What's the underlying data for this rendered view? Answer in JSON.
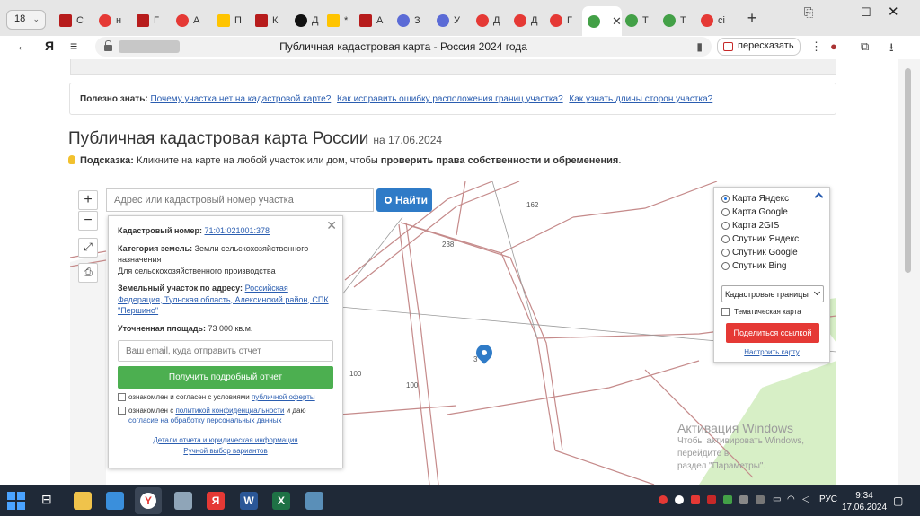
{
  "browser": {
    "tab_count": "18",
    "tabs": [
      {
        "label": "С",
        "fav": "f-e"
      },
      {
        "label": "н",
        "fav": "f-y"
      },
      {
        "label": "Г",
        "fav": "f-e"
      },
      {
        "label": "А",
        "fav": "f-y"
      },
      {
        "label": "П",
        "fav": "f-f"
      },
      {
        "label": "К",
        "fav": "f-e"
      },
      {
        "label": "Д",
        "fav": "f-k"
      },
      {
        "label": "*",
        "fav": "f-f"
      },
      {
        "label": "А",
        "fav": "f-e"
      },
      {
        "label": "З",
        "fav": "f-m"
      },
      {
        "label": "У",
        "fav": "f-m"
      },
      {
        "label": "Д",
        "fav": "f-y"
      },
      {
        "label": "Д",
        "fav": "f-y"
      },
      {
        "label": "Г",
        "fav": "f-y"
      },
      {
        "label": "",
        "fav": "f-g"
      },
      {
        "label": "Т",
        "fav": "f-g"
      },
      {
        "label": "Т",
        "fav": "f-g"
      },
      {
        "label": "ci",
        "fav": "f-y"
      }
    ],
    "page_title": "Публичная кадастровая карта - Россия 2024 года",
    "retell_label": "пересказать"
  },
  "page": {
    "useful_label": "Полезно знать:",
    "useful_links": [
      "Почему участка нет на кадастровой карте?",
      "Как исправить ошибку расположения границ участка?",
      "Как узнать длины сторон участка?"
    ],
    "heading": "Публичная кадастровая карта России",
    "heading_date": "на 17.06.2024",
    "hint_label": "Подсказка:",
    "hint_text": "Кликните на карте на любой участок или дом, чтобы",
    "hint_bold": "проверить права собственности и обременения"
  },
  "map": {
    "search_placeholder": "Адрес или кадастровый номер участка",
    "find_label": "Найти",
    "zoom_in": "+",
    "zoom_out": "−",
    "plot_labels": [
      "162",
      "238",
      "100",
      "100",
      "3"
    ],
    "popup": {
      "cad_label": "Кадастровый номер:",
      "cad_value": "71:01:021001:378",
      "cat_label": "Категория земель:",
      "cat_value": "Земли сельскохозяйственного назначения",
      "cat_value2": "Для сельскохозяйственного производства",
      "addr_label": "Земельный участок по адресу:",
      "addr_value": "Российская Федерация, Тульская область, Алексинский район, СПК \"Першино\"",
      "area_label": "Уточненная площадь:",
      "area_value": "73 000 кв.м.",
      "email_placeholder": "Ваш email, куда отправить отчет",
      "get_report": "Получить подробный отчет",
      "agree1_text": "ознакомлен и согласен с условиями",
      "agree1_link": "публичной оферты",
      "agree2_text": "ознакомлен с",
      "agree2_link": "политикой конфиденциальности",
      "agree2_text2": "и даю",
      "agree2_link2": "согласие на обработку персональных данных",
      "details_link": "Детали отчета и юридическая информация",
      "manual_link": "Ручной выбор вариантов"
    },
    "layers": {
      "options": [
        "Карта Яндекс",
        "Карта Google",
        "Карта 2GIS",
        "Спутник Яндекс",
        "Спутник Google",
        "Спутник Bing"
      ],
      "selected": "Карта Яндекс",
      "overlay_select": "Кадастровые границы",
      "thematic": "Тематическая карта",
      "share": "Поделиться ссылкой",
      "configure": "Настроить карту"
    },
    "watermark": {
      "title": "Активация Windows",
      "line1": "Чтобы активировать Windows, перейдите в",
      "line2": "раздел \"Параметры\"."
    }
  },
  "taskbar": {
    "lang": "РУС",
    "time": "9:34",
    "date": "17.06.2024"
  }
}
